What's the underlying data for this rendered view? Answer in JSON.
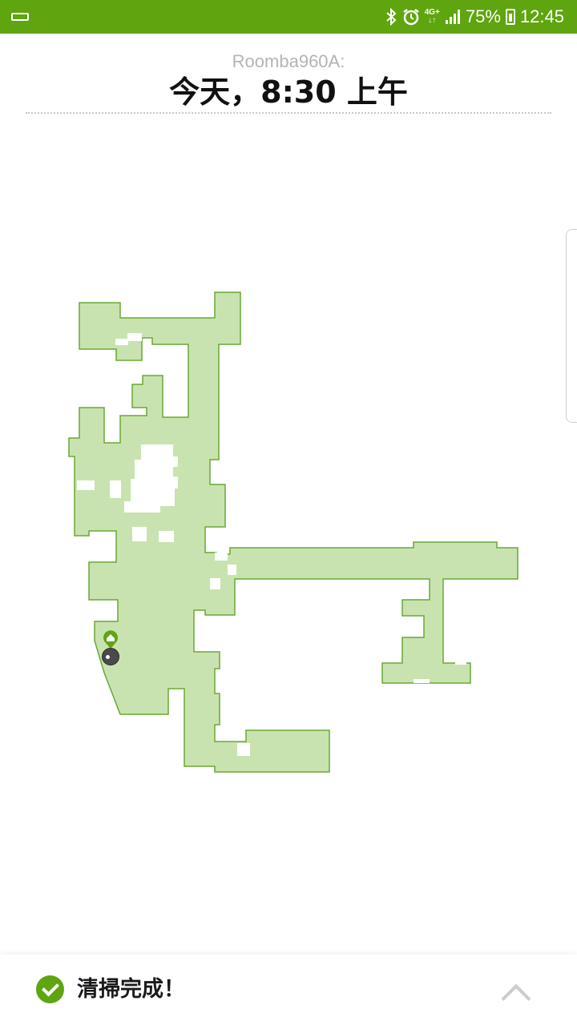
{
  "status_bar": {
    "icons": [
      "notification-icon",
      "bluetooth-icon",
      "alarm-icon",
      "network-4g-icon",
      "signal-icon",
      "battery-charging-icon"
    ],
    "network_label_top": "4G+",
    "network_label_bottom": "↓↑",
    "battery_percent": "75%",
    "time": "12:45"
  },
  "header": {
    "robot_name": "Roomba960A:",
    "run_time": "今天，8:30 上午"
  },
  "map": {
    "colors": {
      "cleaned_fill": "#c9e3b0",
      "cleaned_stroke": "#6aa834",
      "dock_marker": "#5fa50f",
      "robot": "#4a4a4a"
    },
    "icons": [
      "home-dock-icon",
      "robot-icon"
    ]
  },
  "bottom": {
    "status_text": "清掃完成！",
    "icons": [
      "check-circle-icon",
      "chevron-up-icon"
    ],
    "accent": "#5fa50f"
  }
}
